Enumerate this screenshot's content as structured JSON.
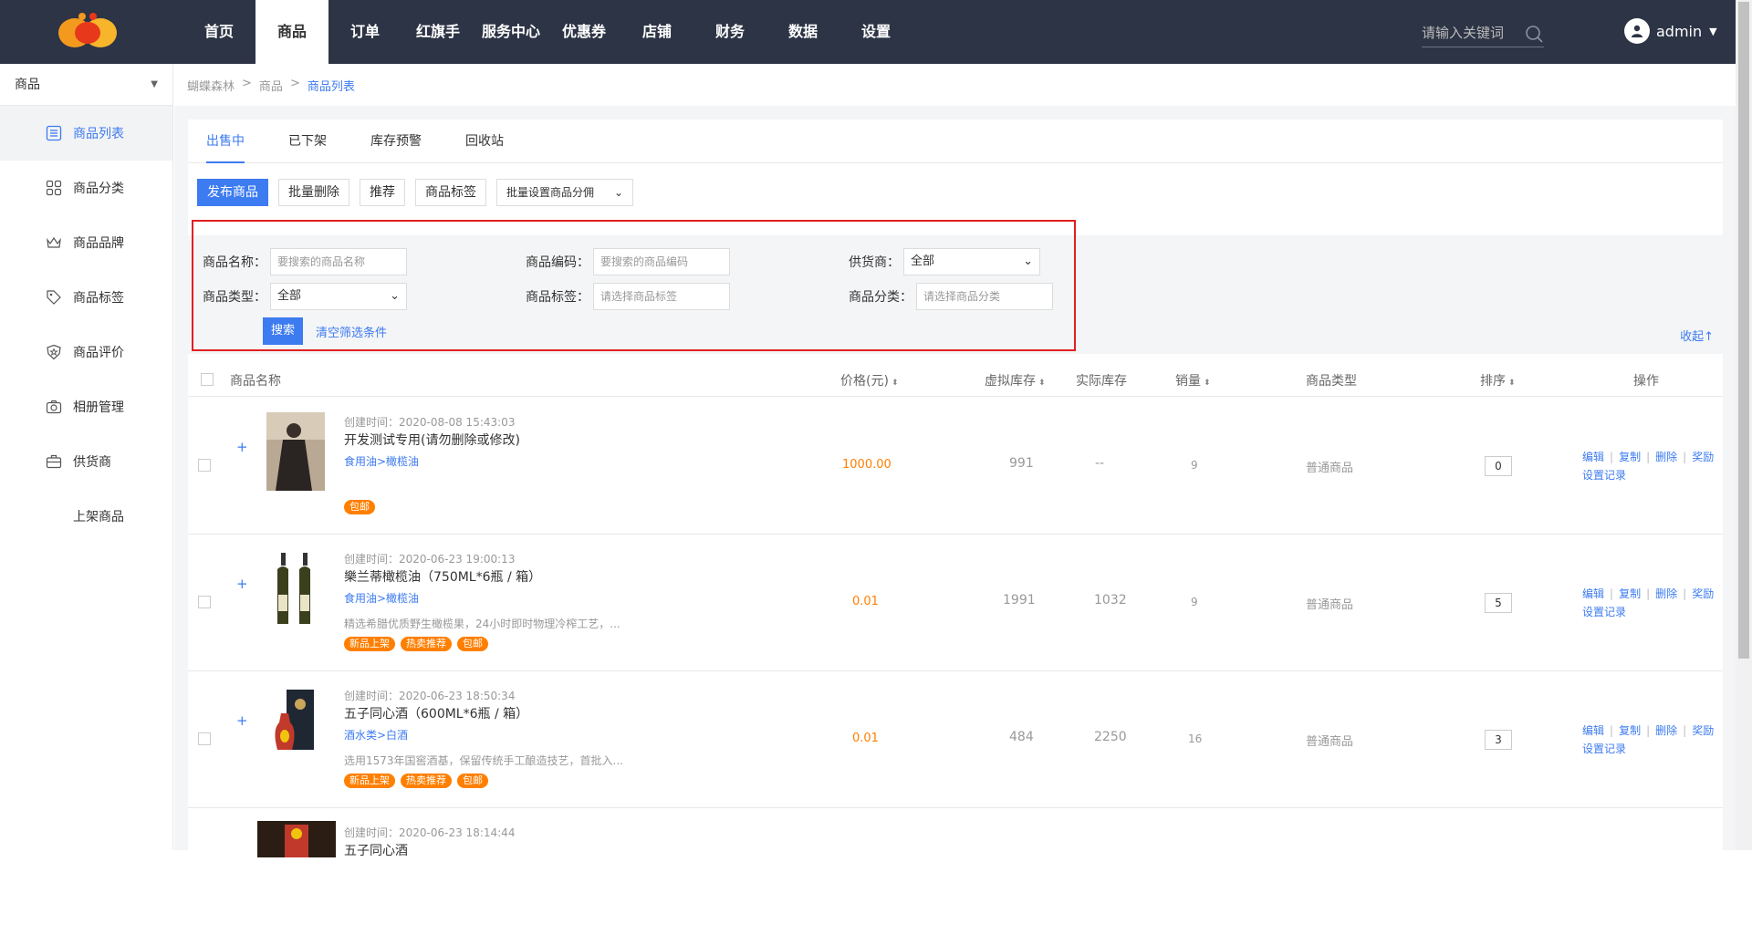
{
  "nav": {
    "items": [
      "首页",
      "商品",
      "订单",
      "红旗手",
      "服务中心",
      "优惠券",
      "店铺",
      "财务",
      "数据",
      "设置"
    ],
    "active_index": 1
  },
  "search": {
    "placeholder": "请输入关键词"
  },
  "user": {
    "name": "admin"
  },
  "sidebar": {
    "header": "商品",
    "items": [
      {
        "label": "商品列表",
        "icon": "list-icon"
      },
      {
        "label": "商品分类",
        "icon": "grid-icon"
      },
      {
        "label": "商品品牌",
        "icon": "crown-icon"
      },
      {
        "label": "商品标签",
        "icon": "tag-icon"
      },
      {
        "label": "商品评价",
        "icon": "shield-star-icon"
      },
      {
        "label": "相册管理",
        "icon": "camera-icon"
      },
      {
        "label": "供货商",
        "icon": "briefcase-icon"
      },
      {
        "label": "上架商品",
        "icon": ""
      }
    ]
  },
  "breadcrumb": {
    "root": "蝴蝶森林",
    "sep": ">",
    "parent": "商品",
    "current": "商品列表"
  },
  "tabs": [
    "出售中",
    "已下架",
    "库存预警",
    "回收站"
  ],
  "toolbar": {
    "publish": "发布商品",
    "batch_delete": "批量删除",
    "recommend": "推荐",
    "tags": "商品标签",
    "batch_commission": "批量设置商品分佣"
  },
  "filter": {
    "name_label": "商品名称：",
    "name_placeholder": "要搜索的商品名称",
    "code_label": "商品编码：",
    "code_placeholder": "要搜索的商品编码",
    "supplier_label": "供货商：",
    "supplier_value": "全部",
    "type_label": "商品类型：",
    "type_value": "全部",
    "tag_label": "商品标签：",
    "tag_placeholder": "请选择商品标签",
    "category_label": "商品分类：",
    "category_placeholder": "请选择商品分类",
    "search_btn": "搜索",
    "clear_btn": "清空筛选条件",
    "collapse": "收起↑"
  },
  "table": {
    "headers": {
      "name": "商品名称",
      "price": "价格(元)",
      "virtual_stock": "虚拟库存",
      "real_stock": "实际库存",
      "sales": "销量",
      "type": "商品类型",
      "sort": "排序",
      "ops": "操作"
    },
    "ops": {
      "edit": "编辑",
      "copy": "复制",
      "delete": "删除",
      "reward": "奖励设置记录"
    },
    "rows": [
      {
        "created": "创建时间：2020-08-08 15:43:03",
        "name": "开发测试专用(请勿删除或修改)",
        "category": "食用油>橄榄油",
        "desc": "",
        "badges": [
          "包邮"
        ],
        "price": "1000.00",
        "virtual_stock": "991",
        "real_stock": "--",
        "sales": "9",
        "type": "普通商品",
        "sort": "0"
      },
      {
        "created": "创建时间：2020-06-23 19:00:13",
        "name": "樂兰蒂橄榄油（750ML*6瓶 / 箱）",
        "category": "食用油>橄榄油",
        "desc": "精选希腊优质野生橄榄果，24小时即时物理冷榨工艺，...",
        "badges": [
          "新品上架",
          "热卖推荐",
          "包邮"
        ],
        "price": "0.01",
        "virtual_stock": "1991",
        "real_stock": "1032",
        "sales": "9",
        "type": "普通商品",
        "sort": "5"
      },
      {
        "created": "创建时间：2020-06-23 18:50:34",
        "name": "五子同心酒（600ML*6瓶 / 箱）",
        "category": "酒水类>白酒",
        "desc": "选用1573年国窖酒基，保留传统手工酿造技艺，首批入...",
        "badges": [
          "新品上架",
          "热卖推荐",
          "包邮"
        ],
        "price": "0.01",
        "virtual_stock": "484",
        "real_stock": "2250",
        "sales": "16",
        "type": "普通商品",
        "sort": "3"
      },
      {
        "created": "创建时间：2020-06-23 18:14:44",
        "name": "五子同心酒",
        "category": "",
        "desc": "",
        "badges": [],
        "price": "",
        "virtual_stock": "",
        "real_stock": "",
        "sales": "",
        "type": "",
        "sort": ""
      }
    ]
  },
  "colors": {
    "accent": "#3d7bf0",
    "topbar": "#2d3445",
    "badge": "#ff7f00",
    "highlight": "#e02020"
  }
}
